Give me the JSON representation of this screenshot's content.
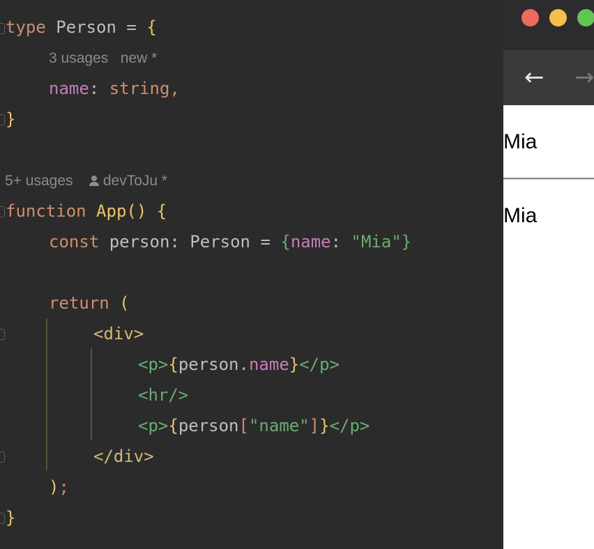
{
  "editor": {
    "lines": [
      {
        "kw": "type",
        "sp": " ",
        "ident": "Person",
        "eq": " = ",
        "brace": "{"
      },
      {
        "prop": "name",
        "colon": ": ",
        "kw": "string",
        "comma": ","
      },
      {
        "brace": "}"
      },
      {
        "kw": "function",
        "sp": " ",
        "fn": "App",
        "paren": "()",
        "sp2": " ",
        "brace": "{"
      },
      {
        "kw": "const",
        "sp": " ",
        "ident": "person",
        "colon": ": ",
        "type": "Person",
        "eq": " = ",
        "brace_open": "{",
        "prop": "name",
        "colon2": ": ",
        "str": "\"Mia\"",
        "brace_close": "}"
      },
      {
        "kw": "return",
        "sp": " ",
        "paren": "("
      },
      {
        "tag": "<div>"
      },
      {
        "tag_open": "<p>",
        "brace_open": "{",
        "ident": "person",
        "dot": ".",
        "prop": "name",
        "brace_close": "}",
        "tag_close": "</p>"
      },
      {
        "tag": "<hr/>"
      },
      {
        "tag_open": "<p>",
        "brace_open": "{",
        "ident": "person",
        "bracket_open": "[",
        "str": "\"name\"",
        "bracket_close": "]",
        "brace_close": "}",
        "tag_close": "</p>"
      },
      {
        "tag": "</div>"
      },
      {
        "paren": ")",
        "semi": ";"
      },
      {
        "brace": "}"
      }
    ],
    "hints": {
      "type_usages": "3 usages",
      "type_author": "new *",
      "func_usages": "5+ usages",
      "func_author": "devToJu *"
    }
  },
  "browser": {
    "traffic_lights": {
      "close": "#ee6a5f",
      "minimize": "#f5bf4f",
      "maximize": "#61c554"
    },
    "back_icon": "arrow-left-icon",
    "forward_icon": "arrow-right-icon",
    "paragraph_1": "Mia",
    "paragraph_2": "Mia"
  }
}
